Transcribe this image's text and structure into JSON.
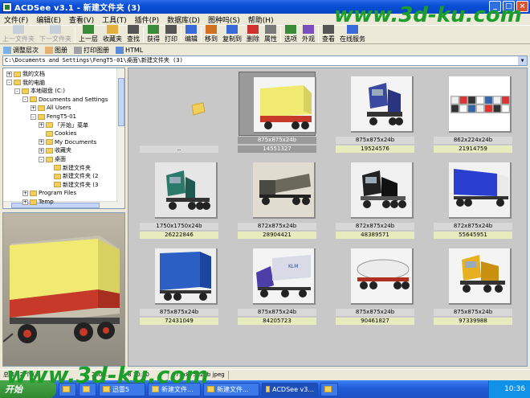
{
  "window": {
    "title": "ACDSee v3.1 - 新建文件夹 (3)"
  },
  "menu": [
    "文件(F)",
    "编辑(E)",
    "查看(V)",
    "工具(T)",
    "插件(P)",
    "数据库(D)",
    "图种吗(S)",
    "帮助(H)"
  ],
  "toolbar": [
    {
      "label": "上一文件夹",
      "disabled": true
    },
    {
      "label": "下一文件夹",
      "disabled": true
    },
    {
      "label": "上一层",
      "disabled": false
    },
    {
      "label": "收藏夹",
      "disabled": false
    },
    {
      "label": "查找",
      "disabled": false
    },
    {
      "label": "获得",
      "disabled": false
    },
    {
      "label": "打印",
      "disabled": false
    },
    {
      "label": "编辑",
      "disabled": false
    },
    {
      "label": "移到",
      "disabled": false
    },
    {
      "label": "复制到",
      "disabled": false
    },
    {
      "label": "删除",
      "disabled": false
    },
    {
      "label": "属性",
      "disabled": false
    },
    {
      "label": "选项",
      "disabled": false
    },
    {
      "label": "外观",
      "disabled": false
    },
    {
      "label": "查看",
      "disabled": false
    },
    {
      "label": "在线服务",
      "disabled": false
    }
  ],
  "toolbar2": [
    "调整层次",
    "图册",
    "打印图册",
    "HTML"
  ],
  "address": "C:\\Documents and Settings\\FengT5-01\\桌面\\新建文件夹 (3)",
  "tree": [
    {
      "label": "我的文档",
      "indent": 0,
      "exp": "+"
    },
    {
      "label": "我的电脑",
      "indent": 0,
      "exp": "-"
    },
    {
      "label": "本地磁盘 (C:)",
      "indent": 1,
      "exp": "-"
    },
    {
      "label": "Documents and Settings",
      "indent": 2,
      "exp": "-"
    },
    {
      "label": "All Users",
      "indent": 3,
      "exp": "+"
    },
    {
      "label": "FengT5-01",
      "indent": 3,
      "exp": "-"
    },
    {
      "label": "「开始」菜单",
      "indent": 4,
      "exp": "+"
    },
    {
      "label": "Cookies",
      "indent": 4,
      "exp": ""
    },
    {
      "label": "My Documents",
      "indent": 4,
      "exp": "+"
    },
    {
      "label": "收藏夹",
      "indent": 4,
      "exp": "+"
    },
    {
      "label": "桌面",
      "indent": 4,
      "exp": "-"
    },
    {
      "label": "新建文件夹",
      "indent": 5,
      "exp": ""
    },
    {
      "label": "新建文件夹 (2",
      "indent": 5,
      "exp": ""
    },
    {
      "label": "新建文件夹 (3",
      "indent": 5,
      "exp": ""
    },
    {
      "label": "Program Files",
      "indent": 2,
      "exp": "+"
    },
    {
      "label": "Temp",
      "indent": 2,
      "exp": "+"
    }
  ],
  "thumbnails": [
    {
      "info": "",
      "size": "..",
      "kind": "folder"
    },
    {
      "info": "875x875x24b",
      "size": "14551327",
      "kind": "tarp",
      "selected": true
    },
    {
      "info": "875x875x24b",
      "size": "19524576",
      "kind": "cab-blue"
    },
    {
      "info": "862x224x24b",
      "size": "21914759",
      "kind": "grid"
    },
    {
      "info": "1750x1750x24b",
      "size": "26222846",
      "kind": "cab-green"
    },
    {
      "info": "872x875x24b",
      "size": "28904421",
      "kind": "old"
    },
    {
      "info": "872x875x24b",
      "size": "48389571",
      "kind": "cab-black"
    },
    {
      "info": "872x875x24b",
      "size": "55645951",
      "kind": "box-blue"
    },
    {
      "info": "875x875x24b",
      "size": "72431049",
      "kind": "container"
    },
    {
      "info": "875x875x24b",
      "size": "84205723",
      "kind": "klm"
    },
    {
      "info": "875x875x24b",
      "size": "90461827",
      "kind": "tanker"
    },
    {
      "info": "875x875x24b",
      "size": "97339988",
      "kind": "cab-yellow"
    }
  ],
  "status": [
    "总数 12 个 (...",
    "2007...",
    "8 10:20",
    "875x875x24b jpeg"
  ],
  "taskbar": {
    "start": "开始",
    "tasks": [
      "",
      "",
      "迅雷5",
      "新建文件...",
      "新建文件...",
      "ACDSee v3...",
      ""
    ],
    "clock": "10:36"
  },
  "watermark": "www.3d-ku.com",
  "colors": {
    "title_blue": "#0a4fd6",
    "thumb_bg": "#c8c8c8",
    "size_bar": "#e6ecbe"
  }
}
